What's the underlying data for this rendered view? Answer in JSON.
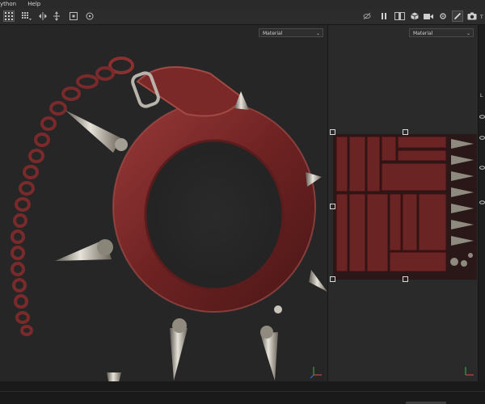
{
  "menu": {
    "items": [
      "ython",
      "Help"
    ]
  },
  "toolbar": {
    "left_icons": [
      "grid-view-icon",
      "grid-dropdown-icon",
      "symmetry-icon",
      "move-icon",
      "frame-icon",
      "camera-target-icon"
    ],
    "right_icons": [
      "visibility-off-icon",
      "pause-icon",
      "split-view-icon",
      "cube-icon",
      "video-icon",
      "settings-icon",
      "brush-icon",
      "camera-icon"
    ]
  },
  "viewport3d": {
    "channel_select": "Material"
  },
  "viewport2d": {
    "channel_select": "Material"
  },
  "side_panel": {
    "label_l": "L",
    "label_t": "T",
    "icons": [
      "eye-icon",
      "eye-icon",
      "eye-icon",
      "eye-icon"
    ]
  },
  "colors": {
    "accent": "#3a7bd5",
    "leather": "#7a2a2a",
    "metal": "#b8b4aa"
  }
}
